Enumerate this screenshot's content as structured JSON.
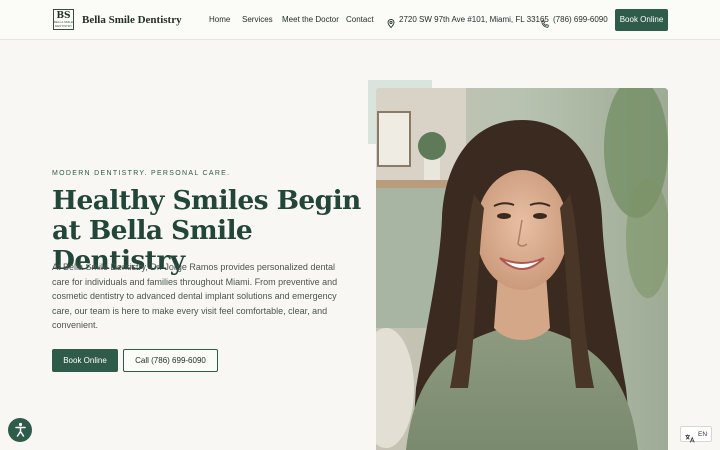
{
  "brand": {
    "name": "Bella Smile Dentistry",
    "logo_mark": "BS",
    "logo_subtext": "BELLA SMILE DENTISTRY"
  },
  "nav": {
    "items": [
      {
        "label": "Home"
      },
      {
        "label": "Services"
      },
      {
        "label": "Meet the Doctor"
      },
      {
        "label": "Contact"
      }
    ],
    "address": "2720 SW 97th Ave #101, Miami, FL 33165",
    "phone": "(786) 699-6090",
    "book_label": "Book Online"
  },
  "hero": {
    "eyebrow": "MODERN DENTISTRY. PERSONAL CARE.",
    "title": "Healthy Smiles Begin at Bella Smile Dentistry",
    "description": "At Bella Smile Dentistry, Dr. Jorge Ramos provides personalized dental care for individuals and families throughout Miami. From preventive and cosmetic dentistry to advanced dental implant solutions and emergency care, our team is here to make every visit feel comfortable, clear, and convenient.",
    "primary_cta": "Book Online",
    "secondary_cta": "Call (786) 699-6090"
  },
  "widgets": {
    "language": "EN",
    "accessibility_icon": "accessibility-icon",
    "translate_icon": "translate-icon"
  },
  "icons": {
    "address": "map-pin-icon",
    "phone": "phone-icon"
  },
  "colors": {
    "primary": "#2f5b4b",
    "heading": "#23463a",
    "background": "#f8f7f3",
    "accent_block": "#d9e5dc"
  }
}
